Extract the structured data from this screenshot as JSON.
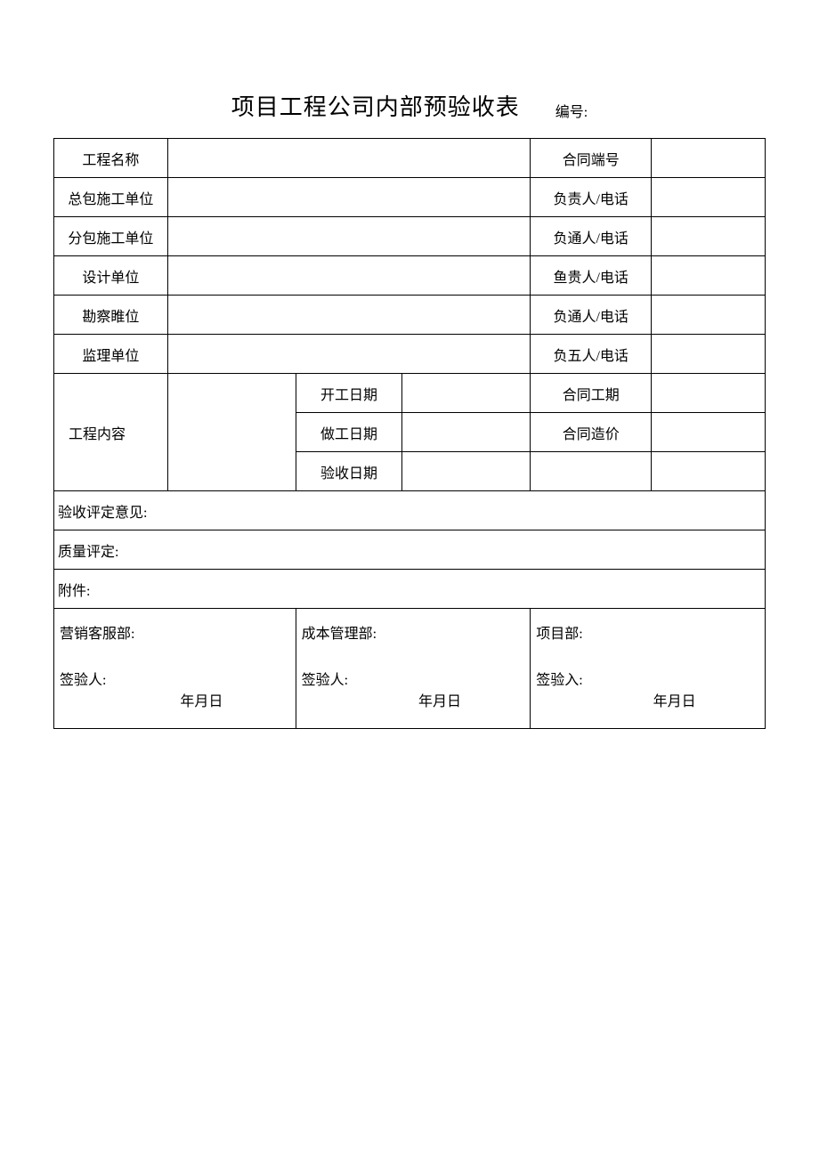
{
  "header": {
    "title": "项目工程公司内部预验收表",
    "serial_label": "编号:"
  },
  "rows": {
    "project_name_label": "工程名称",
    "contract_no_label": "合同端号",
    "general_contractor_label": "总包施工单位",
    "gc_contact_label": "负责人/电话",
    "sub_contractor_label": "分包施工单位",
    "sc_contact_label": "负通人/电话",
    "design_unit_label": "设计单位",
    "design_contact_label": "鱼贵人/电话",
    "survey_unit_label": "勘察睢位",
    "survey_contact_label": "负通人/电话",
    "supervision_unit_label": "监理单位",
    "supervision_contact_label": "负五人/电话",
    "project_content_label": "工程内容",
    "start_date_label": "开工日期",
    "contract_period_label": "合同工期",
    "finish_date_label": "做工日期",
    "contract_price_label": "合同造价",
    "accept_date_label": "验收日期"
  },
  "sections": {
    "opinion_label": "验收评定意见:",
    "quality_label": "质量评定:",
    "attachment_label": "附件:"
  },
  "signoff": {
    "col1_dept": "营销客服部:",
    "col1_signer": "签验人:",
    "col2_dept": "成本管理部:",
    "col2_signer": "签验人:",
    "col3_dept": "项目部:",
    "col3_signer": "签验入:",
    "date_text": "年月日"
  }
}
